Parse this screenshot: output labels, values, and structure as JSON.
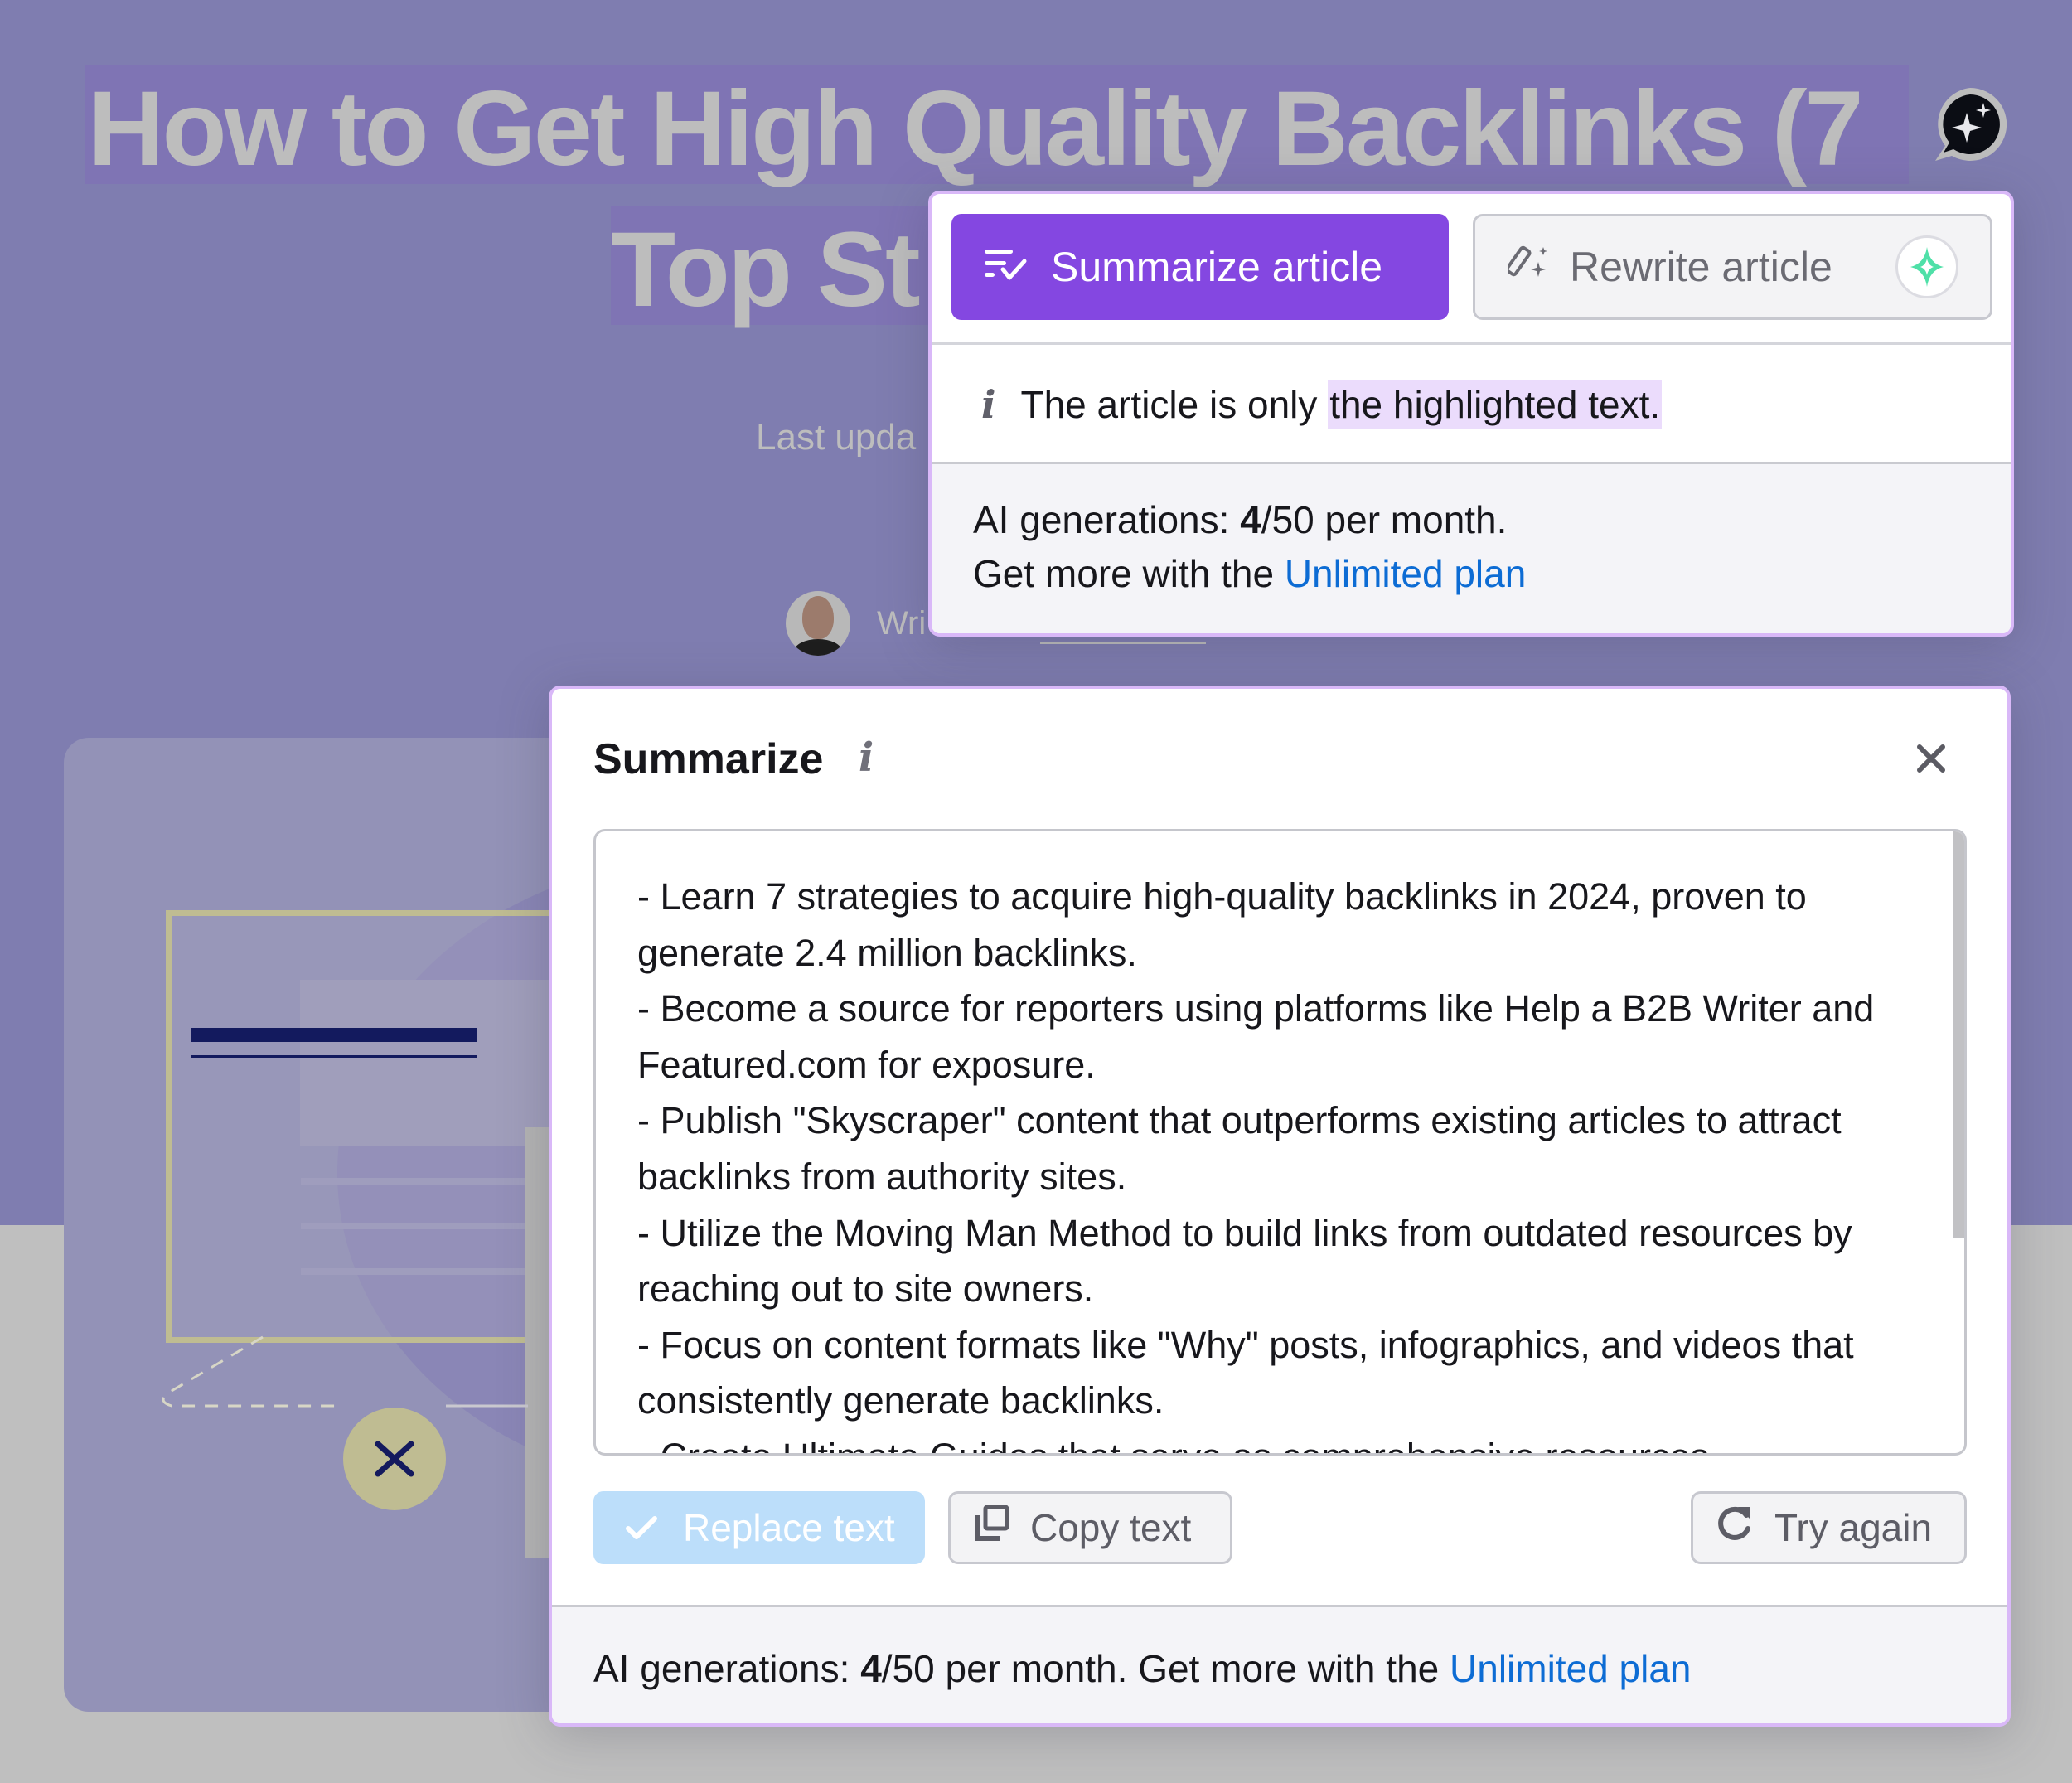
{
  "article": {
    "title_line1": "How to Get High Quality Backlinks (7",
    "title_line2": "Top St",
    "last_updated_prefix": "Last upda",
    "written_by_prefix": "Wri"
  },
  "ai_assistant": {
    "bubble_icon": "chat-sparkle-icon"
  },
  "action_popup": {
    "summarize_label": "Summarize article",
    "summarize_icon": "list-check-icon",
    "rewrite_label": "Rewrite article",
    "rewrite_icon": "wand-sparkle-icon",
    "rewrite_badge_icon": "sparkle-icon",
    "info_icon": "info-icon",
    "info_prefix": "The article is only ",
    "info_highlight": "the highlighted text.",
    "usage_prefix": "AI generations: ",
    "usage_used": "4",
    "usage_suffix": "/50 per month.",
    "upsell_prefix": "Get more with the ",
    "upsell_link": "Unlimited plan"
  },
  "summarize_panel": {
    "title": "Summarize",
    "info_icon": "info-icon",
    "close_icon": "close-icon",
    "summary_text": "- Learn 7 strategies to acquire high-quality backlinks in 2024, proven to generate 2.4 million backlinks.\n- Become a source for reporters using platforms like Help a B2B Writer and Featured.com for exposure.\n- Publish \"Skyscraper\" content that outperforms existing articles to attract backlinks from authority sites.\n- Utilize the Moving Man Method to build links from outdated resources by reaching out to site owners.\n- Focus on content formats like \"Why\" posts, infographics, and videos that consistently generate backlinks.\n- Create Ultimate Guides that serve as comprehensive resources",
    "replace_label": "Replace text",
    "copy_label": "Copy text",
    "try_again_label": "Try again",
    "usage_prefix": "AI generations: ",
    "usage_used": "4",
    "usage_suffix": "/50 per month. Get more with the ",
    "upsell_link": "Unlimited plan"
  },
  "colors": {
    "accent_purple": "#8447e1",
    "popup_border": "#d9b8f8",
    "highlight": "#ebdcfc",
    "link_blue": "#0d6cd4",
    "replace_disabled": "#bcdefa",
    "sparkle_green": "#4fe0a8"
  }
}
